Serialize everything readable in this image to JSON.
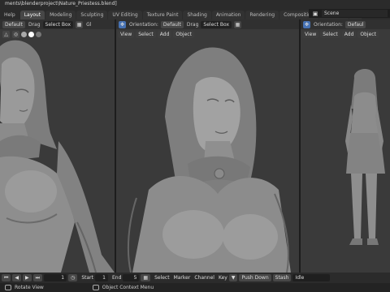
{
  "window": {
    "title_path": "ments\\blenderproject\\Nature_Priestess.blend]"
  },
  "tabs": [
    {
      "label": "Help"
    },
    {
      "label": "Layout"
    },
    {
      "label": "Modeling"
    },
    {
      "label": "Sculpting"
    },
    {
      "label": "UV Editing"
    },
    {
      "label": "Texture Paint"
    },
    {
      "label": "Shading"
    },
    {
      "label": "Animation"
    },
    {
      "label": "Rendering"
    },
    {
      "label": "Compositing"
    },
    {
      "label": "Scripting"
    },
    {
      "label": "+"
    }
  ],
  "active_tab": "Layout",
  "scene": {
    "label": "Scene"
  },
  "viewports": {
    "left": {
      "orientation_value": "Default",
      "drag_label": "Drag",
      "select_mode": "Select Box",
      "extra": "Gl"
    },
    "mid": {
      "orientation_label": "Orientation:",
      "orientation_value": "Default",
      "drag_label": "Drag",
      "select_mode": "Select Box",
      "menus": [
        "View",
        "Select",
        "Add",
        "Object"
      ]
    },
    "right": {
      "orientation_label": "Orientation:",
      "orientation_value": "Defaul",
      "menus": [
        "View",
        "Select",
        "Add",
        "Object"
      ]
    }
  },
  "timeline": {
    "current_frame": "1",
    "start_label": "Start",
    "start_value": "1",
    "end_label": "End",
    "end_value": "5",
    "menus": [
      "Select",
      "Marker",
      "Channel",
      "Key"
    ],
    "push_down": "Push Down",
    "stash": "Stash",
    "action": "Idle"
  },
  "status_bar": {
    "rotate": "Rotate View",
    "context": "Object Context Menu"
  },
  "colors": {
    "viewport_bg": "#3a3a3a",
    "header_bg": "#303030",
    "accent_blue": "#4772b3",
    "model_gray": "#8e8e8e"
  }
}
